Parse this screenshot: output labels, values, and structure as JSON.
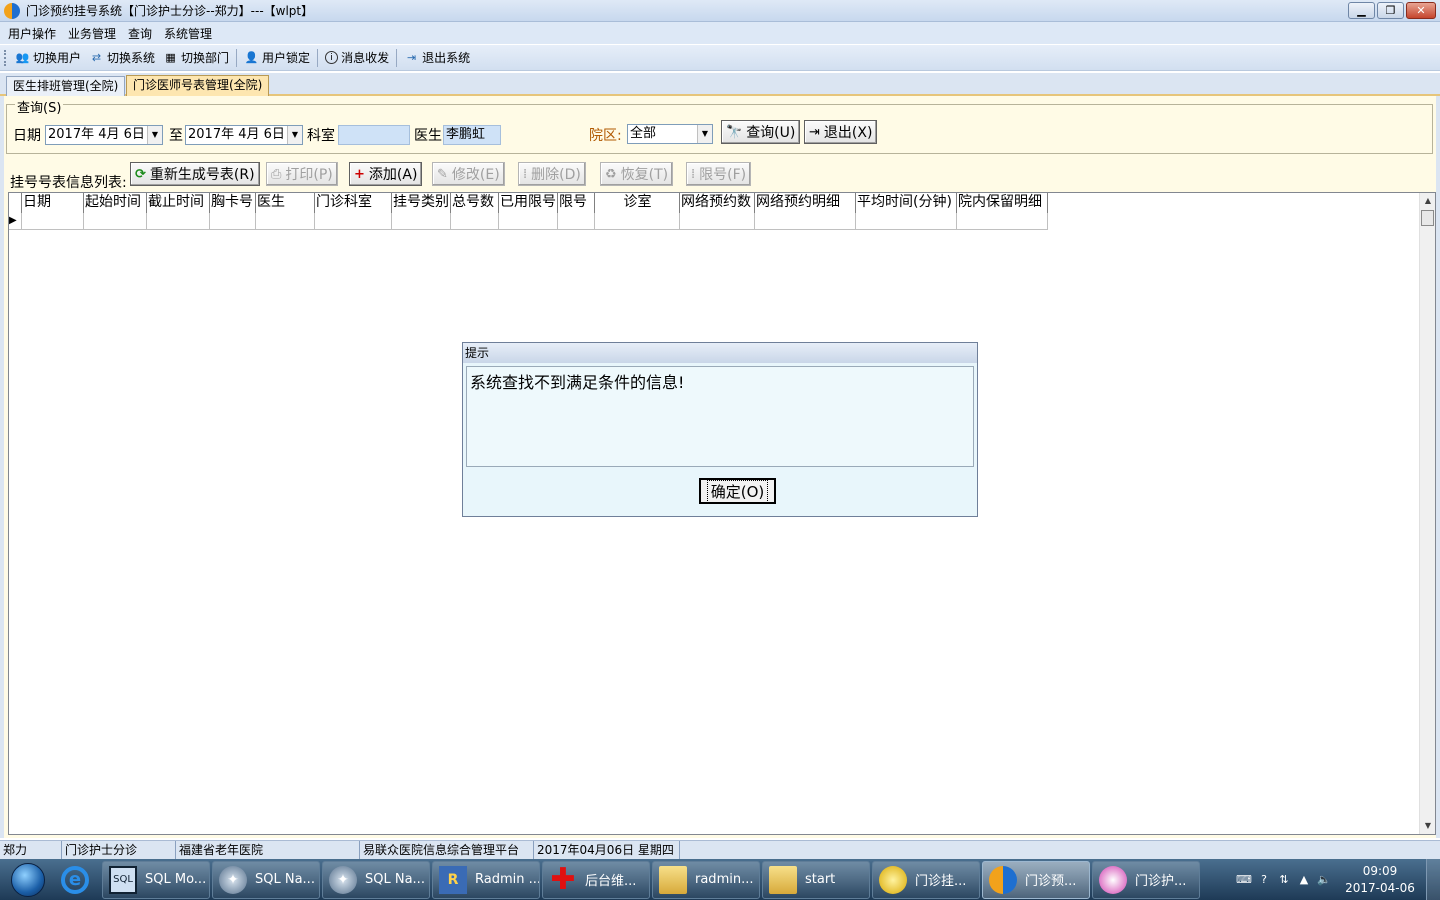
{
  "window": {
    "title": "门诊预约挂号系统【门诊护士分诊--郑力】---【wlpt】"
  },
  "menu": {
    "items": [
      "用户操作",
      "业务管理",
      "查询",
      "系统管理"
    ]
  },
  "toolbar": {
    "items": [
      {
        "label": "切换用户",
        "icon": "switch-user-icon"
      },
      {
        "label": "切换系统",
        "icon": "switch-system-icon"
      },
      {
        "label": "切换部门",
        "icon": "switch-department-icon"
      },
      {
        "label": "用户锁定",
        "icon": "lock-user-icon"
      },
      {
        "label": "消息收发",
        "icon": "info-icon"
      },
      {
        "label": "退出系统",
        "icon": "exit-icon"
      }
    ]
  },
  "tabs": [
    {
      "label": "医生排班管理(全院)"
    },
    {
      "label": "门诊医师号表管理(全院)",
      "active": true
    }
  ],
  "query": {
    "legend": "查询(S)",
    "date_label": "日期",
    "date_from": "2017年 4月 6日",
    "to_label": "至",
    "date_to": "2017年 4月 6日",
    "dept_label": "科室",
    "dept_value": "",
    "doctor_label": "医生",
    "doctor_value": "李鹏虹",
    "campus_label": "院区:",
    "campus_value": "全部",
    "search_btn": "查询(U)",
    "exit_btn": "退出(X)"
  },
  "actions": {
    "list_label": "挂号号表信息列表:",
    "regen": "重新生成号表(R)",
    "print": "打印(P)",
    "add": "添加(A)",
    "edit": "修改(E)",
    "delete": "删除(D)",
    "restore": "恢复(T)",
    "limit": "限号(F)"
  },
  "grid": {
    "columns": [
      "日期",
      "起始时间",
      "截止时间",
      "胸卡号",
      "医生",
      "门诊科室",
      "挂号类别",
      "总号数",
      "已用限号",
      "限号",
      "诊室",
      "网络预约数",
      "网络预约明细",
      "平均时间(分钟)",
      "院内保留明细"
    ],
    "row_indicator": "▶"
  },
  "dialog": {
    "title": "提示",
    "message": "系统查找不到满足条件的信息!",
    "ok": "确定(O)"
  },
  "status": [
    "郑力",
    "门诊护士分诊",
    "福建省老年医院",
    "易联众医院信息综合管理平台",
    "2017年04月06日  星期四"
  ],
  "taskbar": {
    "tasks": [
      {
        "label": "SQL Mo...",
        "icon": "sql-monitor-icon"
      },
      {
        "label": "SQL Na...",
        "icon": "navicat-icon"
      },
      {
        "label": "SQL Na...",
        "icon": "navicat-icon"
      },
      {
        "label": "Radmin ...",
        "icon": "radmin-icon"
      },
      {
        "label": "后台维...",
        "icon": "red-cross-icon"
      },
      {
        "label": "radmin...",
        "icon": "folder-icon"
      },
      {
        "label": "start",
        "icon": "folder-icon"
      },
      {
        "label": "门诊挂...",
        "icon": "app-icon"
      },
      {
        "label": "门诊预...",
        "icon": "app-icon",
        "active": true
      },
      {
        "label": "门诊护...",
        "icon": "app-icon"
      }
    ],
    "time": "09:09",
    "date": "2017-04-06"
  }
}
